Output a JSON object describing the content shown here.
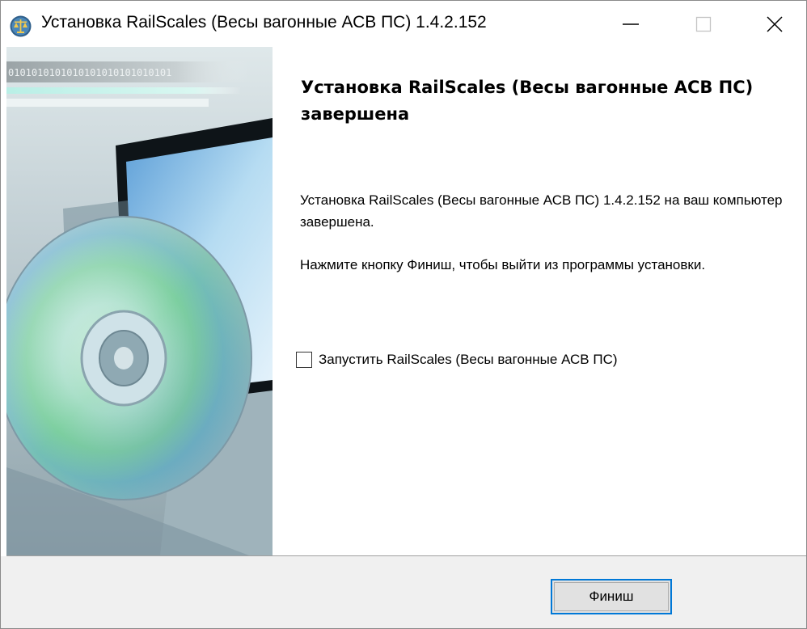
{
  "window": {
    "title": "Установка RailScales (Весы вагонные АСВ ПС) 1.4.2.152",
    "icon": "scales-app-icon",
    "controls": [
      "minimize-icon",
      "maximize-icon",
      "close-icon"
    ]
  },
  "banner": {
    "binary_strip": "0101010101010101010101010101"
  },
  "content": {
    "heading": "Установка RailScales (Весы вагонные АСВ ПС) завершена",
    "paragraph1": "Установка RailScales (Весы вагонные АСВ ПС) 1.4.2.152 на ваш компьютер завершена.",
    "paragraph2": "Нажмите кнопку Финиш, чтобы выйти из программы установки.",
    "checkbox_label": "Запустить RailScales (Весы вагонные АСВ ПС)",
    "checkbox_checked": false
  },
  "footer": {
    "finish_label": "Финиш"
  },
  "colors": {
    "accent": "#0078d7",
    "footer_bg": "#f0f0f0",
    "banner_bg": "#9fb1b8"
  }
}
